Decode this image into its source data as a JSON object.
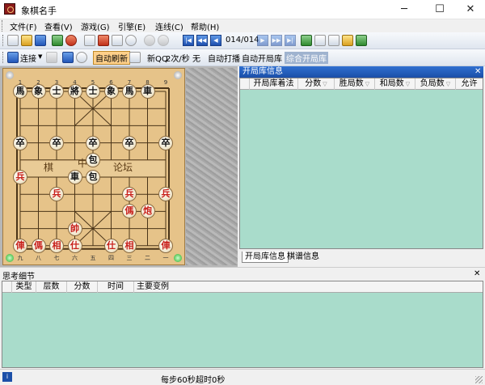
{
  "window": {
    "title": "象棋名手",
    "min": "─",
    "max": "☐",
    "close": "✕"
  },
  "menu": [
    {
      "label": "文件(F)"
    },
    {
      "label": "查看(V)"
    },
    {
      "label": "游戏(G)"
    },
    {
      "label": "引擎(E)"
    },
    {
      "label": "连线(C)"
    },
    {
      "label": "帮助(H)"
    }
  ],
  "toolbar1": {
    "move_counter": "014/014"
  },
  "toolbar2": {
    "connect": "连接",
    "auto_refresh": "自动刷新",
    "engine_name": "新QQ",
    "rate": "2次/秒",
    "none": "无",
    "auto_play": "自动打播",
    "auto_open_book": "自动开局库",
    "combined_book": "综合开局库"
  },
  "board": {
    "files_top": [
      "1",
      "2",
      "3",
      "4",
      "5",
      "6",
      "7",
      "8",
      "9"
    ],
    "files_bottom": [
      "九",
      "八",
      "七",
      "六",
      "五",
      "四",
      "三",
      "二",
      "一"
    ],
    "river_left": "棋",
    "river_mid": "中",
    "river_right": "论坛",
    "pieces": [
      {
        "t": "馬",
        "s": "black",
        "c": 0,
        "r": 0
      },
      {
        "t": "象",
        "s": "black",
        "c": 1,
        "r": 0
      },
      {
        "t": "士",
        "s": "black",
        "c": 2,
        "r": 0
      },
      {
        "t": "將",
        "s": "black",
        "c": 3,
        "r": 0
      },
      {
        "t": "士",
        "s": "black",
        "c": 4,
        "r": 0
      },
      {
        "t": "象",
        "s": "black",
        "c": 5,
        "r": 0
      },
      {
        "t": "馬",
        "s": "black",
        "c": 6,
        "r": 0
      },
      {
        "t": "車",
        "s": "black",
        "c": 7,
        "r": 0
      },
      {
        "t": "卒",
        "s": "black",
        "c": 0,
        "r": 3
      },
      {
        "t": "卒",
        "s": "black",
        "c": 2,
        "r": 3
      },
      {
        "t": "卒",
        "s": "black",
        "c": 4,
        "r": 3
      },
      {
        "t": "卒",
        "s": "black",
        "c": 6,
        "r": 3
      },
      {
        "t": "卒",
        "s": "black",
        "c": 8,
        "r": 3
      },
      {
        "t": "包",
        "s": "black",
        "c": 4,
        "r": 4
      },
      {
        "t": "車",
        "s": "black",
        "c": 3,
        "r": 5
      },
      {
        "t": "包",
        "s": "black",
        "c": 4,
        "r": 5
      },
      {
        "t": "兵",
        "s": "red",
        "c": 0,
        "r": 5
      },
      {
        "t": "兵",
        "s": "red",
        "c": 2,
        "r": 6
      },
      {
        "t": "兵",
        "s": "red",
        "c": 6,
        "r": 6
      },
      {
        "t": "兵",
        "s": "red",
        "c": 8,
        "r": 6
      },
      {
        "t": "傌",
        "s": "red",
        "c": 6,
        "r": 7
      },
      {
        "t": "炮",
        "s": "red",
        "c": 7,
        "r": 7
      },
      {
        "t": "帥",
        "s": "red",
        "c": 3,
        "r": 8
      },
      {
        "t": "俥",
        "s": "red",
        "c": 0,
        "r": 9
      },
      {
        "t": "傌",
        "s": "red",
        "c": 1,
        "r": 9
      },
      {
        "t": "相",
        "s": "red",
        "c": 2,
        "r": 9
      },
      {
        "t": "仕",
        "s": "red",
        "c": 3,
        "r": 9
      },
      {
        "t": "仕",
        "s": "red",
        "c": 5,
        "r": 9
      },
      {
        "t": "相",
        "s": "red",
        "c": 6,
        "r": 9
      },
      {
        "t": "俥",
        "s": "red",
        "c": 8,
        "r": 9
      }
    ]
  },
  "book_panel": {
    "title": "开局库信息",
    "columns": [
      "开局库着法",
      "分数",
      "胜局数",
      "和局数",
      "负局数",
      "允许"
    ],
    "tabs": [
      "开局库信息",
      "棋谱信息"
    ]
  },
  "detail_panel": {
    "title": "思考细节",
    "columns": [
      "类型",
      "层数",
      "分数",
      "时间",
      "主要变例"
    ]
  },
  "status": {
    "time_control": "每步60秒",
    "overtime": "超时0秒"
  },
  "colors": {
    "panel_title": "#1b4fa8",
    "pane_fill": "#a9dccb",
    "board": "#e6c389"
  }
}
